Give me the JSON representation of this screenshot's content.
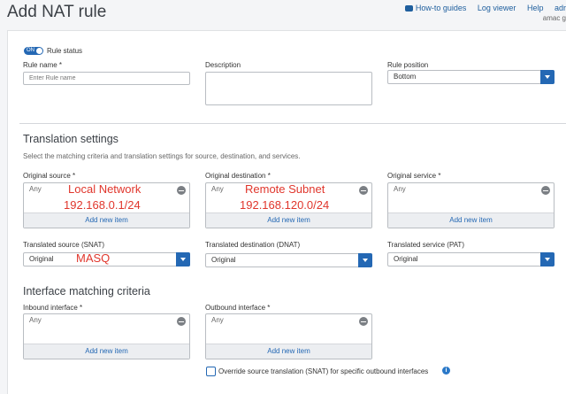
{
  "header": {
    "title": "Add NAT rule",
    "links": {
      "howto": "How-to guides",
      "logviewer": "Log viewer",
      "help": "Help",
      "user": "adr"
    },
    "user_sub": "amac g"
  },
  "rule_status": {
    "toggle_text": "ON",
    "label": "Rule status"
  },
  "rule_name": {
    "label": "Rule name *",
    "placeholder": "Enter Rule name"
  },
  "description": {
    "label": "Description"
  },
  "rule_position": {
    "label": "Rule position",
    "value": "Bottom"
  },
  "translation": {
    "title": "Translation settings",
    "desc": "Select the matching criteria and translation settings for source, destination, and services.",
    "original_source": {
      "label": "Original source *",
      "any": "Any",
      "add": "Add new item"
    },
    "original_destination": {
      "label": "Original destination *",
      "any": "Any",
      "add": "Add new item"
    },
    "original_service": {
      "label": "Original service *",
      "any": "Any",
      "add": "Add new item"
    },
    "translated_source": {
      "label": "Translated source (SNAT)",
      "value": "Original"
    },
    "translated_destination": {
      "label": "Translated destination (DNAT)",
      "value": "Original"
    },
    "translated_service": {
      "label": "Translated service (PAT)",
      "value": "Original"
    }
  },
  "interface": {
    "title": "Interface matching criteria",
    "inbound": {
      "label": "Inbound interface *",
      "any": "Any",
      "add": "Add new item"
    },
    "outbound": {
      "label": "Outbound interface *",
      "any": "Any",
      "add": "Add new item"
    },
    "override_label": "Override source translation (SNAT) for specific outbound interfaces"
  },
  "annotations": {
    "local_network": "Local Network",
    "local_subnet": "192.168.0.1/24",
    "remote_subnet": "Remote Subnet",
    "remote_cidr": "192.168.120.0/24",
    "masq": "MASQ"
  },
  "colors": {
    "accent": "#2468b4",
    "annotation": "#e0362c"
  }
}
